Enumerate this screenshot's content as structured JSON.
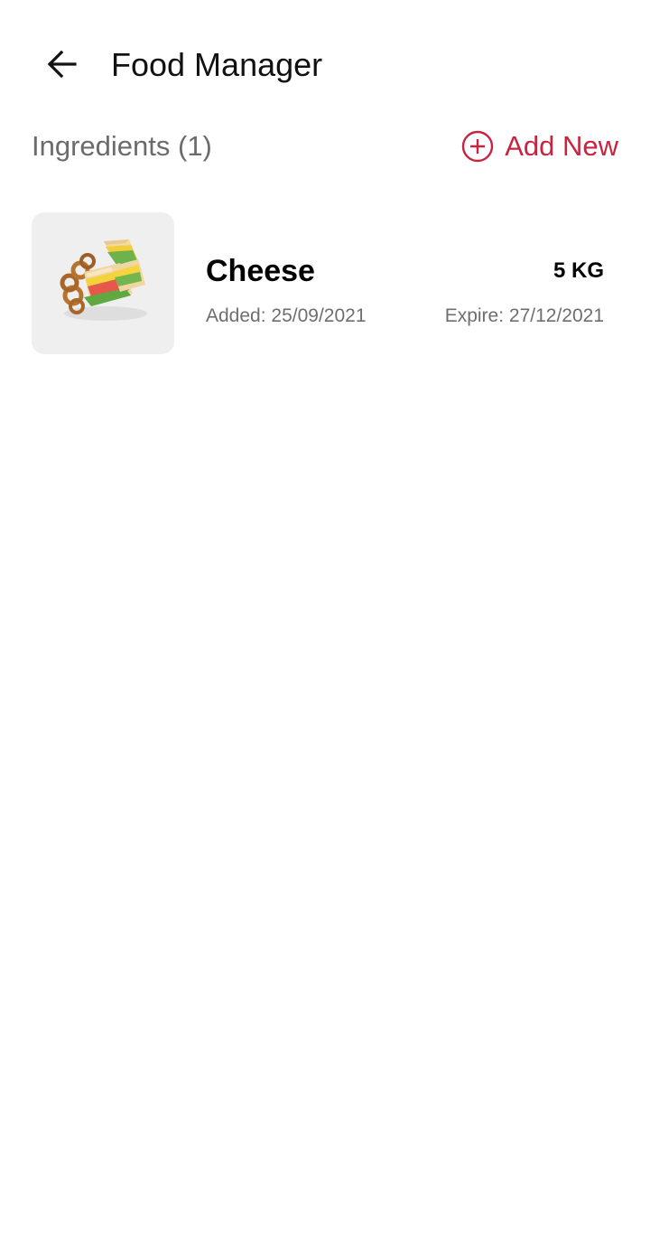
{
  "app_bar": {
    "back_icon": "arrow-left-icon",
    "title": "Food Manager"
  },
  "section": {
    "title": "Ingredients (1)",
    "add_icon": "plus-circle-icon",
    "add_label": "Add New",
    "accent_color": "#c8243f"
  },
  "ingredients": [
    {
      "name": "Cheese",
      "quantity": "5 KG",
      "added": "Added: 25/09/2021",
      "expire": "Expire: 27/12/2021",
      "image": "sandwich-photo"
    }
  ]
}
